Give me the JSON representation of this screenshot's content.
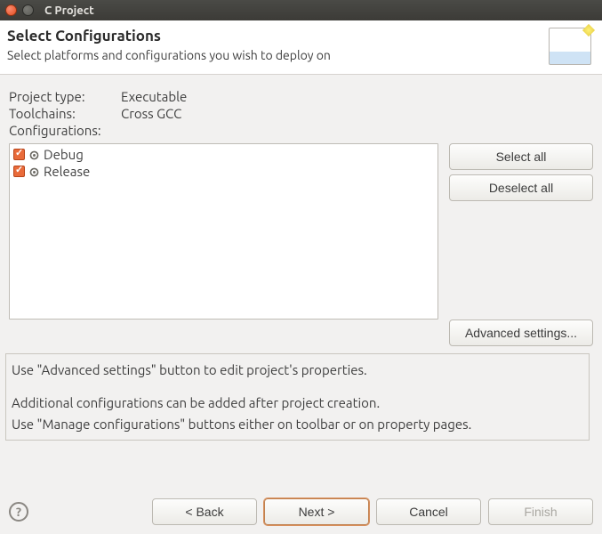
{
  "window": {
    "title": "C Project"
  },
  "header": {
    "title": "Select Configurations",
    "subtitle": "Select platforms and configurations you wish to deploy on"
  },
  "info": {
    "project_type_label": "Project type:",
    "project_type_value": "Executable",
    "toolchains_label": "Toolchains:",
    "toolchains_value": "Cross GCC",
    "configurations_label": "Configurations:"
  },
  "config_items": [
    {
      "name": "Debug",
      "checked": true
    },
    {
      "name": "Release",
      "checked": true
    }
  ],
  "buttons": {
    "select_all": "Select all",
    "deselect_all": "Deselect all",
    "advanced": "Advanced settings..."
  },
  "hints": {
    "line1": "Use \"Advanced settings\" button to edit project's properties.",
    "line2": "Additional configurations can be added after project creation.",
    "line3": "Use \"Manage configurations\" buttons either on toolbar or on property pages."
  },
  "nav": {
    "back": "< Back",
    "next": "Next >",
    "cancel": "Cancel",
    "finish": "Finish"
  }
}
